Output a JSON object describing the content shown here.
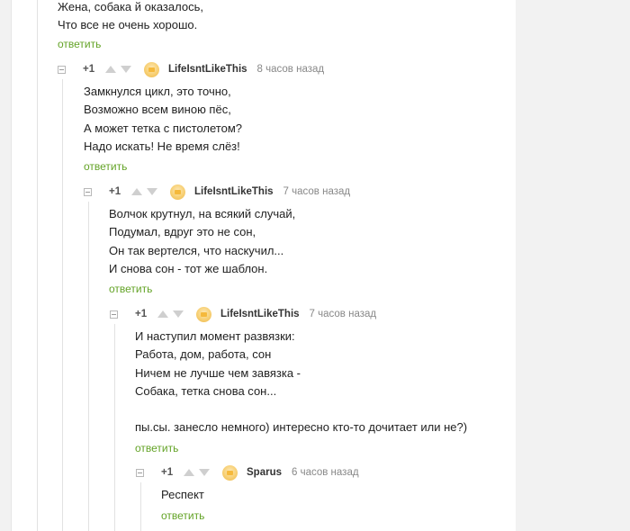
{
  "top_comment": {
    "lines": "Жена, собака й оказалось,\nЧто все не очень хорошо.",
    "reply_label": "ответить"
  },
  "comments": [
    {
      "rating": "+1",
      "author": "LifeIsntLikeThis",
      "time": "8 часов назад",
      "text": "Замкнулся цикл, это точно,\nВозможно всем виною пёс,\nА может тетка с пистолетом?\nНадо искать! Не время слёз!",
      "reply_label": "ответить"
    },
    {
      "rating": "+1",
      "author": "LifeIsntLikeThis",
      "time": "7 часов назад",
      "text": "Волчок крутнул, на всякий случай,\nПодумал, вдруг это не сон,\nОн так вертелся, что наскучил...\nИ снова сон - тот же шаблон.",
      "reply_label": "ответить"
    },
    {
      "rating": "+1",
      "author": "LifeIsntLikeThis",
      "time": "7 часов назад",
      "text": "И наступил момент развязки:\nРабота, дом, работа, сон\nНичем не лучше чем завязка -\nСобака, тетка снова сон...\n\nпы.сы. занесло немного) интересно кто-то дочитает или не?)",
      "reply_label": "ответить"
    },
    {
      "rating": "+1",
      "author": "Sparus",
      "time": "6 часов назад",
      "text": "Респект",
      "reply_label": "ответить"
    }
  ],
  "colors": {
    "reply_link": "#63a326",
    "background": "#f2f2f2",
    "panel": "#ffffff",
    "vote_arrow": "#cfcfcf"
  }
}
